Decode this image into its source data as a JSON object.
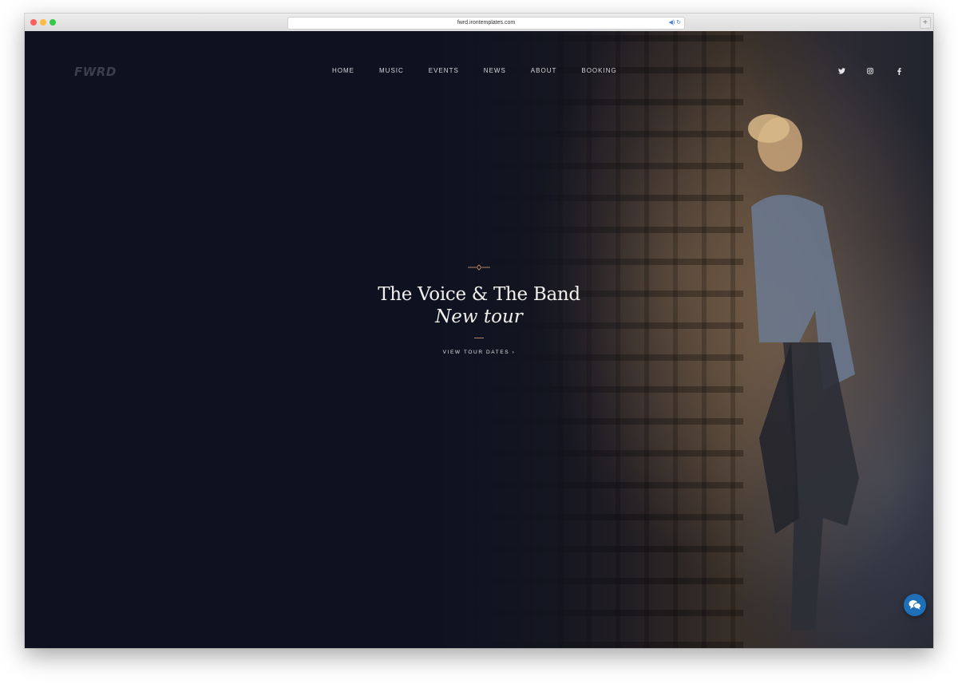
{
  "browser": {
    "url": "fwrd.irontemplates.com"
  },
  "site": {
    "logo": "FWRD",
    "nav": [
      "HOME",
      "MUSIC",
      "EVENTS",
      "NEWS",
      "ABOUT",
      "BOOKING"
    ],
    "social": [
      "twitter-icon",
      "instagram-icon",
      "facebook-icon"
    ]
  },
  "hero": {
    "title": "The Voice & The Band",
    "subtitle": "New tour",
    "cta": "VIEW TOUR DATES ›"
  },
  "colors": {
    "background": "#0d1120",
    "accent": "#b0846a",
    "chat": "#1e6fb8"
  }
}
